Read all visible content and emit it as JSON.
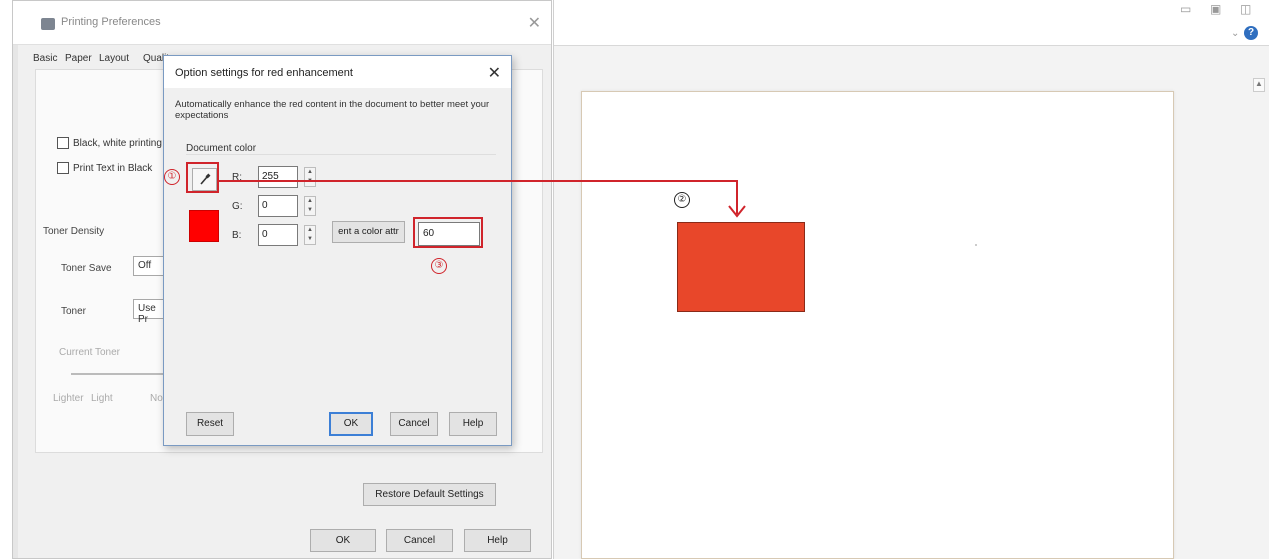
{
  "background_window": {
    "title": "Printing Preferences",
    "close_glyph": "✕",
    "tabs": [
      "Basic",
      "Paper",
      "Layout",
      "Quality"
    ],
    "checkboxes": [
      {
        "label": "Black, white printing",
        "checked": false
      },
      {
        "label": "Print Text in Black",
        "checked": false
      }
    ],
    "toner_density_label": "Toner Density",
    "toner_save_label": "Toner Save",
    "toner_save_value": "Off",
    "toner_label": "Toner",
    "toner_value": "Use Pr",
    "current_toner_label": "Current Toner",
    "scale_labels": [
      "Lighter",
      "Light",
      "No"
    ],
    "restore_button": "Restore Default Settings",
    "ok_button": "OK",
    "cancel_button": "Cancel",
    "help_button": "Help"
  },
  "dialog": {
    "title": "Option settings for red enhancement",
    "close_glyph": "✕",
    "description": "Automatically enhance the red content in the document to better meet your expectations",
    "group_label": "Document color",
    "r_label": "R:",
    "g_label": "G:",
    "b_label": "B:",
    "r_value": "255",
    "g_value": "0",
    "b_value": "0",
    "color_attr_button": "ent a color attr",
    "color_attr_value": "60",
    "reset_button": "Reset",
    "ok_button": "OK",
    "cancel_button": "Cancel",
    "help_button": "Help",
    "swatch_color": "#ff0000"
  },
  "preview": {
    "red_rect_color": "#e8472a",
    "help_glyph": "?"
  },
  "annotations": {
    "marker_1": "①",
    "marker_2": "②",
    "marker_3": "③",
    "color": "#d0242b"
  }
}
